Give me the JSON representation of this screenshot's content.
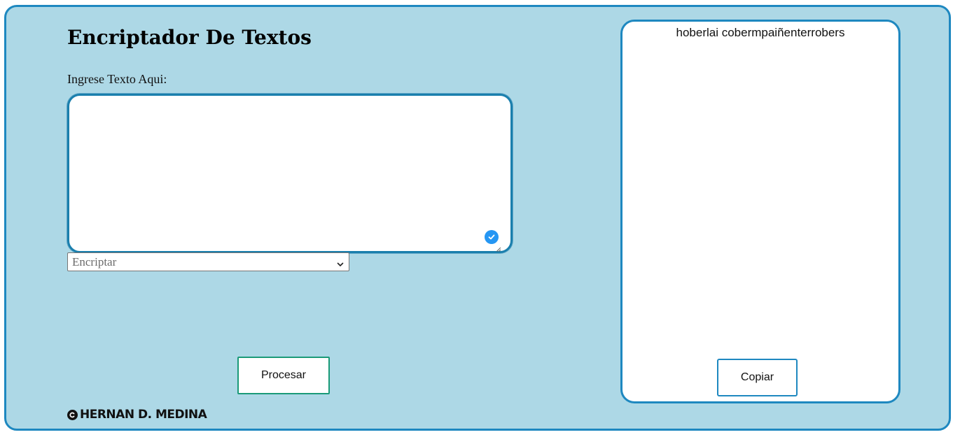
{
  "app": {
    "title": "Encriptador De Textos",
    "input_label": "Ingrese Texto Aqui:",
    "input_value": "",
    "mode_select": {
      "selected": "Encriptar",
      "options": [
        "Encriptar"
      ]
    },
    "process_button": "Procesar",
    "footer_credit": "HERNAN D. MEDINA"
  },
  "output": {
    "text": "hoberlai cobermpaiñenterrobers",
    "copy_button": "Copiar"
  },
  "colors": {
    "background": "#add8e6",
    "accent_border": "#1e88c0",
    "process_border": "#1a9a78",
    "check_badge": "#2596f3"
  },
  "icons": {
    "textarea_status": "check-circle-icon",
    "select_arrow": "chevron-down-icon",
    "copyright": "copyright-icon"
  }
}
